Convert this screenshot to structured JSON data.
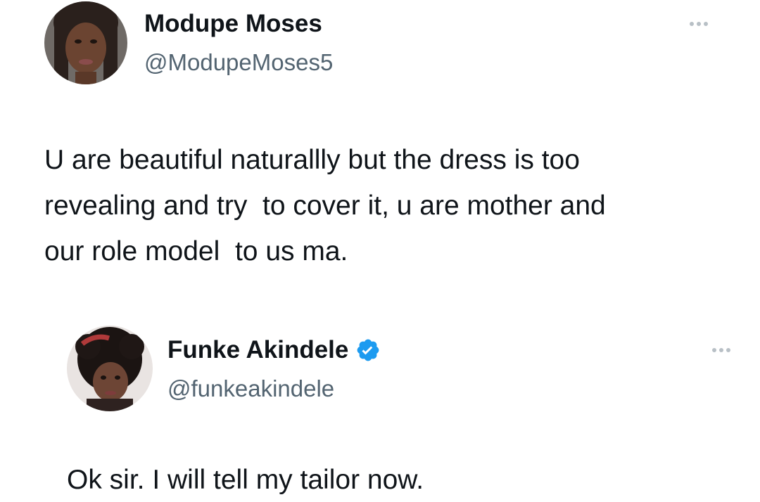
{
  "tweets": [
    {
      "display_name": "Modupe Moses",
      "handle": "@ModupeMoses5",
      "text": "U are beautiful naturallly but the dress is too\nrevealing and try  to cover it, u are mother and\nour role model  to us ma.",
      "verified": false
    },
    {
      "display_name": "Funke Akindele",
      "handle": "@funkeakindele",
      "text": "Ok sir. I will tell my tailor now.",
      "verified": true
    }
  ],
  "icons": {
    "more": "more-horizontal-icon",
    "verified": "verified-badge-icon"
  },
  "colors": {
    "text": "#0f1419",
    "secondary_text": "#536471",
    "verified_blue": "#1d9bf0",
    "more_dots": "#b8c0c6"
  }
}
